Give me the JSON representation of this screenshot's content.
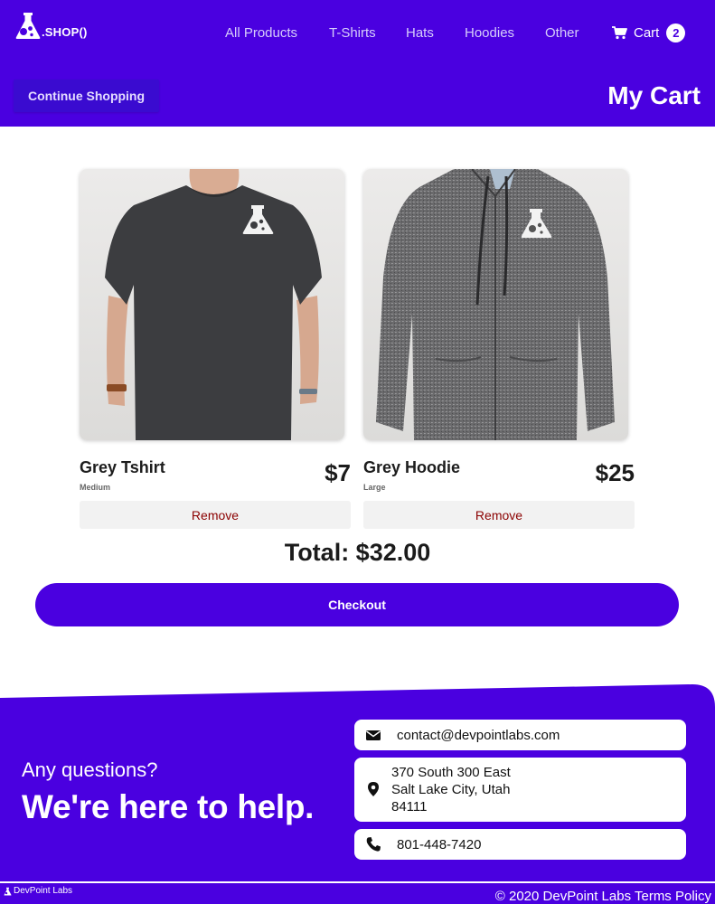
{
  "header": {
    "brand": ".SHOP()",
    "nav": [
      "All Products",
      "T-Shirts",
      "Hats",
      "Hoodies",
      "Other"
    ],
    "cart_label": "Cart",
    "cart_count": "2",
    "continue_label": "Continue Shopping",
    "page_title": "My Cart"
  },
  "cart": {
    "items": [
      {
        "name": "Grey Tshirt",
        "size": "Medium",
        "price": "$7",
        "remove_label": "Remove",
        "image": "grey-tshirt"
      },
      {
        "name": "Grey Hoodie",
        "size": "Large",
        "price": "$25",
        "remove_label": "Remove",
        "image": "grey-hoodie"
      }
    ],
    "total": "Total: $32.00",
    "checkout_label": "Checkout"
  },
  "footer": {
    "question": "Any questions?",
    "help": "We're here to help.",
    "email": "contact@devpointlabs.com",
    "address": [
      "370 South 300 East",
      "Salt Lake City, Utah",
      "84111"
    ],
    "phone": "801-448-7420",
    "brand": "DevPoint Labs",
    "copyright": "© 2020 DevPoint Labs Terms Policy"
  },
  "colors": {
    "primary": "#4a00e0",
    "remove_text": "#8b0000",
    "button_bg": "#f2f2f2"
  },
  "icons": [
    "flask-logo-icon",
    "cart-icon",
    "envelope-icon",
    "map-marker-icon",
    "phone-icon"
  ]
}
